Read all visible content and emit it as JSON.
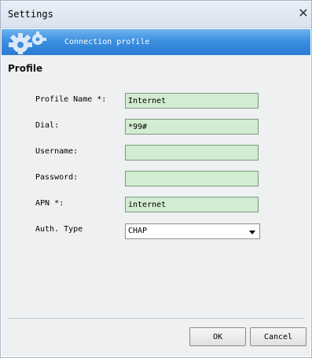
{
  "window": {
    "title": "Settings"
  },
  "banner": {
    "title": "Connection profile"
  },
  "section": {
    "title": "Profile"
  },
  "form": {
    "profile_name": {
      "label": "Profile Name *:",
      "value": "Internet"
    },
    "dial": {
      "label": "Dial:",
      "value": "*99#"
    },
    "username": {
      "label": "Username:",
      "value": ""
    },
    "password": {
      "label": "Password:",
      "value": ""
    },
    "apn": {
      "label": "APN *:",
      "value": "internet"
    },
    "auth_type": {
      "label": "Auth. Type",
      "value": "CHAP"
    }
  },
  "buttons": {
    "ok": "OK",
    "cancel": "Cancel"
  },
  "icons": {
    "close": "close-icon",
    "banner": "gear-icon",
    "dropdown": "chevron-down-icon"
  },
  "colors": {
    "banner": "#3c8fe0",
    "field_bg": "#d1ecd1",
    "panel_bg": "#eef0f2"
  }
}
